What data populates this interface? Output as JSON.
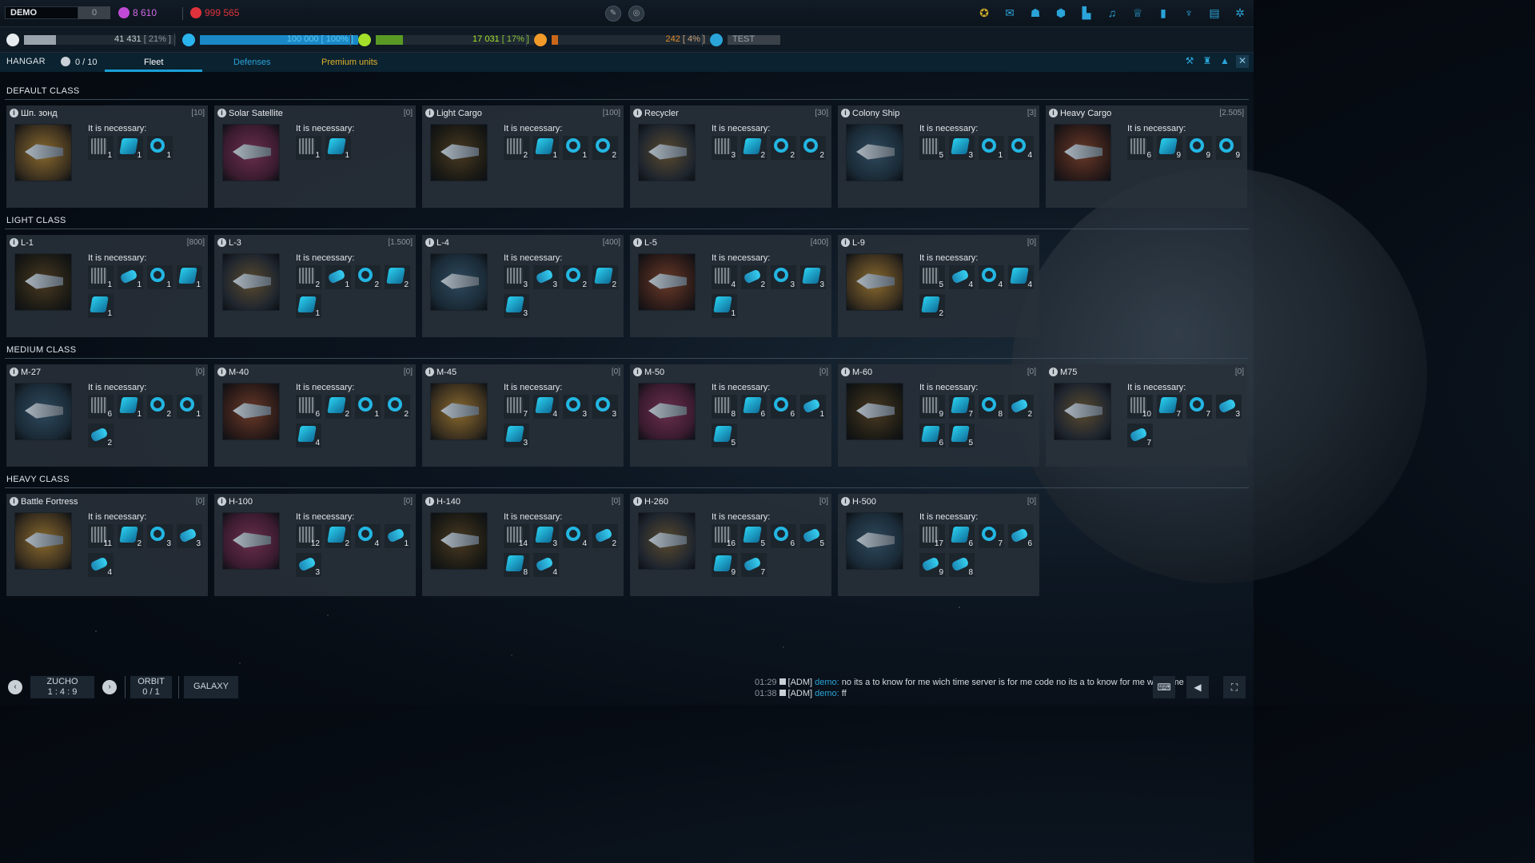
{
  "header": {
    "player": "DEMO",
    "player_count": "0",
    "currency_a": "8 610",
    "currency_b": "999 565",
    "colors": {
      "accent": "#1aa0d6",
      "currency_a": "#c04ad6",
      "currency_b": "#e0323c"
    }
  },
  "resources": [
    {
      "name": "metal",
      "value": "41 431",
      "pct_label": "[ 21% ]",
      "fill": 0.21,
      "color": "#9aa3ab",
      "icon_color": "#c9d0d6"
    },
    {
      "name": "crystal",
      "value": "100 000",
      "pct_label": "[ 100% ]",
      "fill": 1.0,
      "color": "#1a88c6",
      "icon_color": "#2ab4ee"
    },
    {
      "name": "deuterium",
      "value": "17 031",
      "pct_label": "[ 17% ]",
      "fill": 0.17,
      "color": "#5a9a24",
      "icon_color": "#a4e02a"
    },
    {
      "name": "energy",
      "value": "242",
      "pct_label": "[ 4% ]",
      "fill": 0.04,
      "color": "#c8661a",
      "icon_color": "#f09a2a"
    }
  ],
  "planet_name": "TEST",
  "hangar": {
    "title": "HANGAR",
    "slots": "0 / 10"
  },
  "tabs": [
    "Fleet",
    "Defenses",
    "Premium units"
  ],
  "common": {
    "necessary": "It is necessary:"
  },
  "classes": [
    {
      "title": "DEFAULT CLASS",
      "cards": [
        {
          "name": "Шп. зонд",
          "count": "[10]",
          "reqs": [
            [
              "gear",
              "1"
            ],
            [
              "cyan",
              "1"
            ],
            [
              "ring",
              "1"
            ]
          ]
        },
        {
          "name": "Solar Satellite",
          "count": "[0]",
          "reqs": [
            [
              "gear",
              "1"
            ],
            [
              "cyan",
              "1"
            ]
          ]
        },
        {
          "name": "Light Cargo",
          "count": "[100]",
          "reqs": [
            [
              "gear",
              "2"
            ],
            [
              "cyan",
              "1"
            ],
            [
              "ring",
              "1"
            ],
            [
              "ring",
              "2"
            ]
          ]
        },
        {
          "name": "Recycler",
          "count": "[30]",
          "reqs": [
            [
              "gear",
              "3"
            ],
            [
              "cyan",
              "2"
            ],
            [
              "ring",
              "2"
            ],
            [
              "ring",
              "2"
            ]
          ]
        },
        {
          "name": "Colony Ship",
          "count": "[3]",
          "reqs": [
            [
              "gear",
              "5"
            ],
            [
              "cyan",
              "3"
            ],
            [
              "ring",
              "1"
            ],
            [
              "ring",
              "4"
            ]
          ]
        },
        {
          "name": "Heavy Cargo",
          "count": "[2.505]",
          "reqs": [
            [
              "gear",
              "6"
            ],
            [
              "cyan",
              "9"
            ],
            [
              "ring",
              "9"
            ],
            [
              "ring",
              "9"
            ]
          ]
        }
      ]
    },
    {
      "title": "LIGHT CLASS",
      "cards": [
        {
          "name": "L-1",
          "count": "[800]",
          "reqs": [
            [
              "gear",
              "1"
            ],
            [
              "pipe",
              "1"
            ],
            [
              "ring",
              "1"
            ],
            [
              "cyan",
              "1"
            ],
            [
              "cyan",
              "1"
            ]
          ]
        },
        {
          "name": "L-3",
          "count": "[1.500]",
          "reqs": [
            [
              "gear",
              "2"
            ],
            [
              "pipe",
              "1"
            ],
            [
              "ring",
              "2"
            ],
            [
              "cyan",
              "2"
            ],
            [
              "cyan",
              "1"
            ]
          ]
        },
        {
          "name": "L-4",
          "count": "[400]",
          "reqs": [
            [
              "gear",
              "3"
            ],
            [
              "pipe",
              "3"
            ],
            [
              "ring",
              "2"
            ],
            [
              "cyan",
              "2"
            ],
            [
              "cyan",
              "3"
            ]
          ]
        },
        {
          "name": "L-5",
          "count": "[400]",
          "reqs": [
            [
              "gear",
              "4"
            ],
            [
              "pipe",
              "2"
            ],
            [
              "ring",
              "3"
            ],
            [
              "cyan",
              "3"
            ],
            [
              "cyan",
              "1"
            ]
          ]
        },
        {
          "name": "L-9",
          "count": "[0]",
          "reqs": [
            [
              "gear",
              "5"
            ],
            [
              "pipe",
              "4"
            ],
            [
              "ring",
              "4"
            ],
            [
              "cyan",
              "4"
            ],
            [
              "cyan",
              "2"
            ]
          ]
        }
      ]
    },
    {
      "title": "MEDIUM CLASS",
      "cards": [
        {
          "name": "M-27",
          "count": "[0]",
          "reqs": [
            [
              "gear",
              "6"
            ],
            [
              "cyan",
              "1"
            ],
            [
              "ring",
              "2"
            ],
            [
              "ring",
              "1"
            ],
            [
              "pipe",
              "2"
            ]
          ]
        },
        {
          "name": "M-40",
          "count": "[0]",
          "reqs": [
            [
              "gear",
              "6"
            ],
            [
              "cyan",
              "2"
            ],
            [
              "ring",
              "1"
            ],
            [
              "ring",
              "2"
            ],
            [
              "cyan",
              "4"
            ]
          ]
        },
        {
          "name": "M-45",
          "count": "[0]",
          "reqs": [
            [
              "gear",
              "7"
            ],
            [
              "cyan",
              "4"
            ],
            [
              "ring",
              "3"
            ],
            [
              "ring",
              "3"
            ],
            [
              "cyan",
              "3"
            ]
          ]
        },
        {
          "name": "M-50",
          "count": "[0]",
          "reqs": [
            [
              "gear",
              "8"
            ],
            [
              "cyan",
              "6"
            ],
            [
              "ring",
              "6"
            ],
            [
              "pipe",
              "1"
            ],
            [
              "cyan",
              "5"
            ]
          ]
        },
        {
          "name": "M-60",
          "count": "[0]",
          "reqs": [
            [
              "gear",
              "9"
            ],
            [
              "cyan",
              "7"
            ],
            [
              "ring",
              "8"
            ],
            [
              "pipe",
              "2"
            ],
            [
              "cyan",
              "6"
            ],
            [
              "cyan",
              "5"
            ]
          ]
        },
        {
          "name": "M75",
          "count": "[0]",
          "reqs": [
            [
              "gear",
              "10"
            ],
            [
              "cyan",
              "7"
            ],
            [
              "ring",
              "7"
            ],
            [
              "pipe",
              "3"
            ],
            [
              "pipe",
              "7"
            ]
          ]
        }
      ]
    },
    {
      "title": "HEAVY CLASS",
      "cards": [
        {
          "name": "Battle Fortress",
          "count": "[0]",
          "reqs": [
            [
              "gear",
              "11"
            ],
            [
              "cyan",
              "2"
            ],
            [
              "ring",
              "3"
            ],
            [
              "pipe",
              "3"
            ],
            [
              "pipe",
              "4"
            ]
          ]
        },
        {
          "name": "H-100",
          "count": "[0]",
          "reqs": [
            [
              "gear",
              "12"
            ],
            [
              "cyan",
              "2"
            ],
            [
              "ring",
              "4"
            ],
            [
              "pipe",
              "1"
            ],
            [
              "pipe",
              "3"
            ]
          ]
        },
        {
          "name": "H-140",
          "count": "[0]",
          "reqs": [
            [
              "gear",
              "14"
            ],
            [
              "cyan",
              "3"
            ],
            [
              "ring",
              "4"
            ],
            [
              "pipe",
              "2"
            ],
            [
              "cyan",
              "8"
            ],
            [
              "pipe",
              "4"
            ]
          ]
        },
        {
          "name": "H-260",
          "count": "[0]",
          "reqs": [
            [
              "gear",
              "16"
            ],
            [
              "cyan",
              "5"
            ],
            [
              "ring",
              "6"
            ],
            [
              "pipe",
              "5"
            ],
            [
              "cyan",
              "9"
            ],
            [
              "pipe",
              "7"
            ]
          ]
        },
        {
          "name": "H-500",
          "count": "[0]",
          "reqs": [
            [
              "gear",
              "17"
            ],
            [
              "cyan",
              "6"
            ],
            [
              "ring",
              "7"
            ],
            [
              "pipe",
              "6"
            ],
            [
              "pipe",
              "9"
            ],
            [
              "pipe",
              "8"
            ]
          ]
        }
      ]
    }
  ],
  "footer": {
    "planet": "ZUCHO",
    "coords": "1 : 4 : 9",
    "orbit_label": "ORBIT",
    "orbit_value": "0 / 1",
    "galaxy": "GALAXY"
  },
  "chat": [
    {
      "time": "01:29",
      "tag": "[ADM]",
      "user": "demo:",
      "text": "no its a to know for me wich time server is for me code no its a to know for me wich time"
    },
    {
      "time": "01:38",
      "tag": "[ADM]",
      "user": "demo:",
      "text": "ff"
    }
  ]
}
